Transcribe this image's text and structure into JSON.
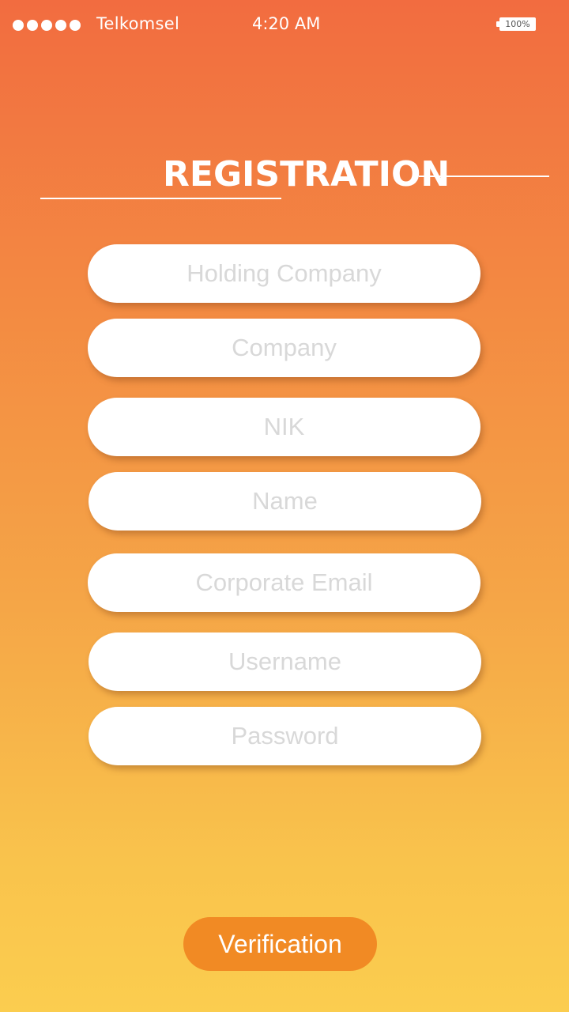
{
  "status_bar": {
    "carrier": "Telkomsel",
    "time": "4:20 AM",
    "battery": "100%",
    "signal_bars": 5
  },
  "page": {
    "title": "REGISTRATION"
  },
  "form": {
    "fields": [
      {
        "id": "holding-company",
        "placeholder": "Holding Company",
        "value": ""
      },
      {
        "id": "company",
        "placeholder": "Company",
        "value": ""
      },
      {
        "id": "nik",
        "placeholder": "NIK",
        "value": ""
      },
      {
        "id": "name",
        "placeholder": "Name",
        "value": ""
      },
      {
        "id": "corporate-email",
        "placeholder": "Corporate Email",
        "value": ""
      },
      {
        "id": "username",
        "placeholder": "Username",
        "value": ""
      },
      {
        "id": "password",
        "placeholder": "Password",
        "value": ""
      }
    ],
    "submit_label": "Verification"
  },
  "colors": {
    "gradient_top": "#f26c40",
    "gradient_bottom": "#fbcd4f",
    "button": "#f18a24",
    "placeholder": "#d8d8d8"
  }
}
